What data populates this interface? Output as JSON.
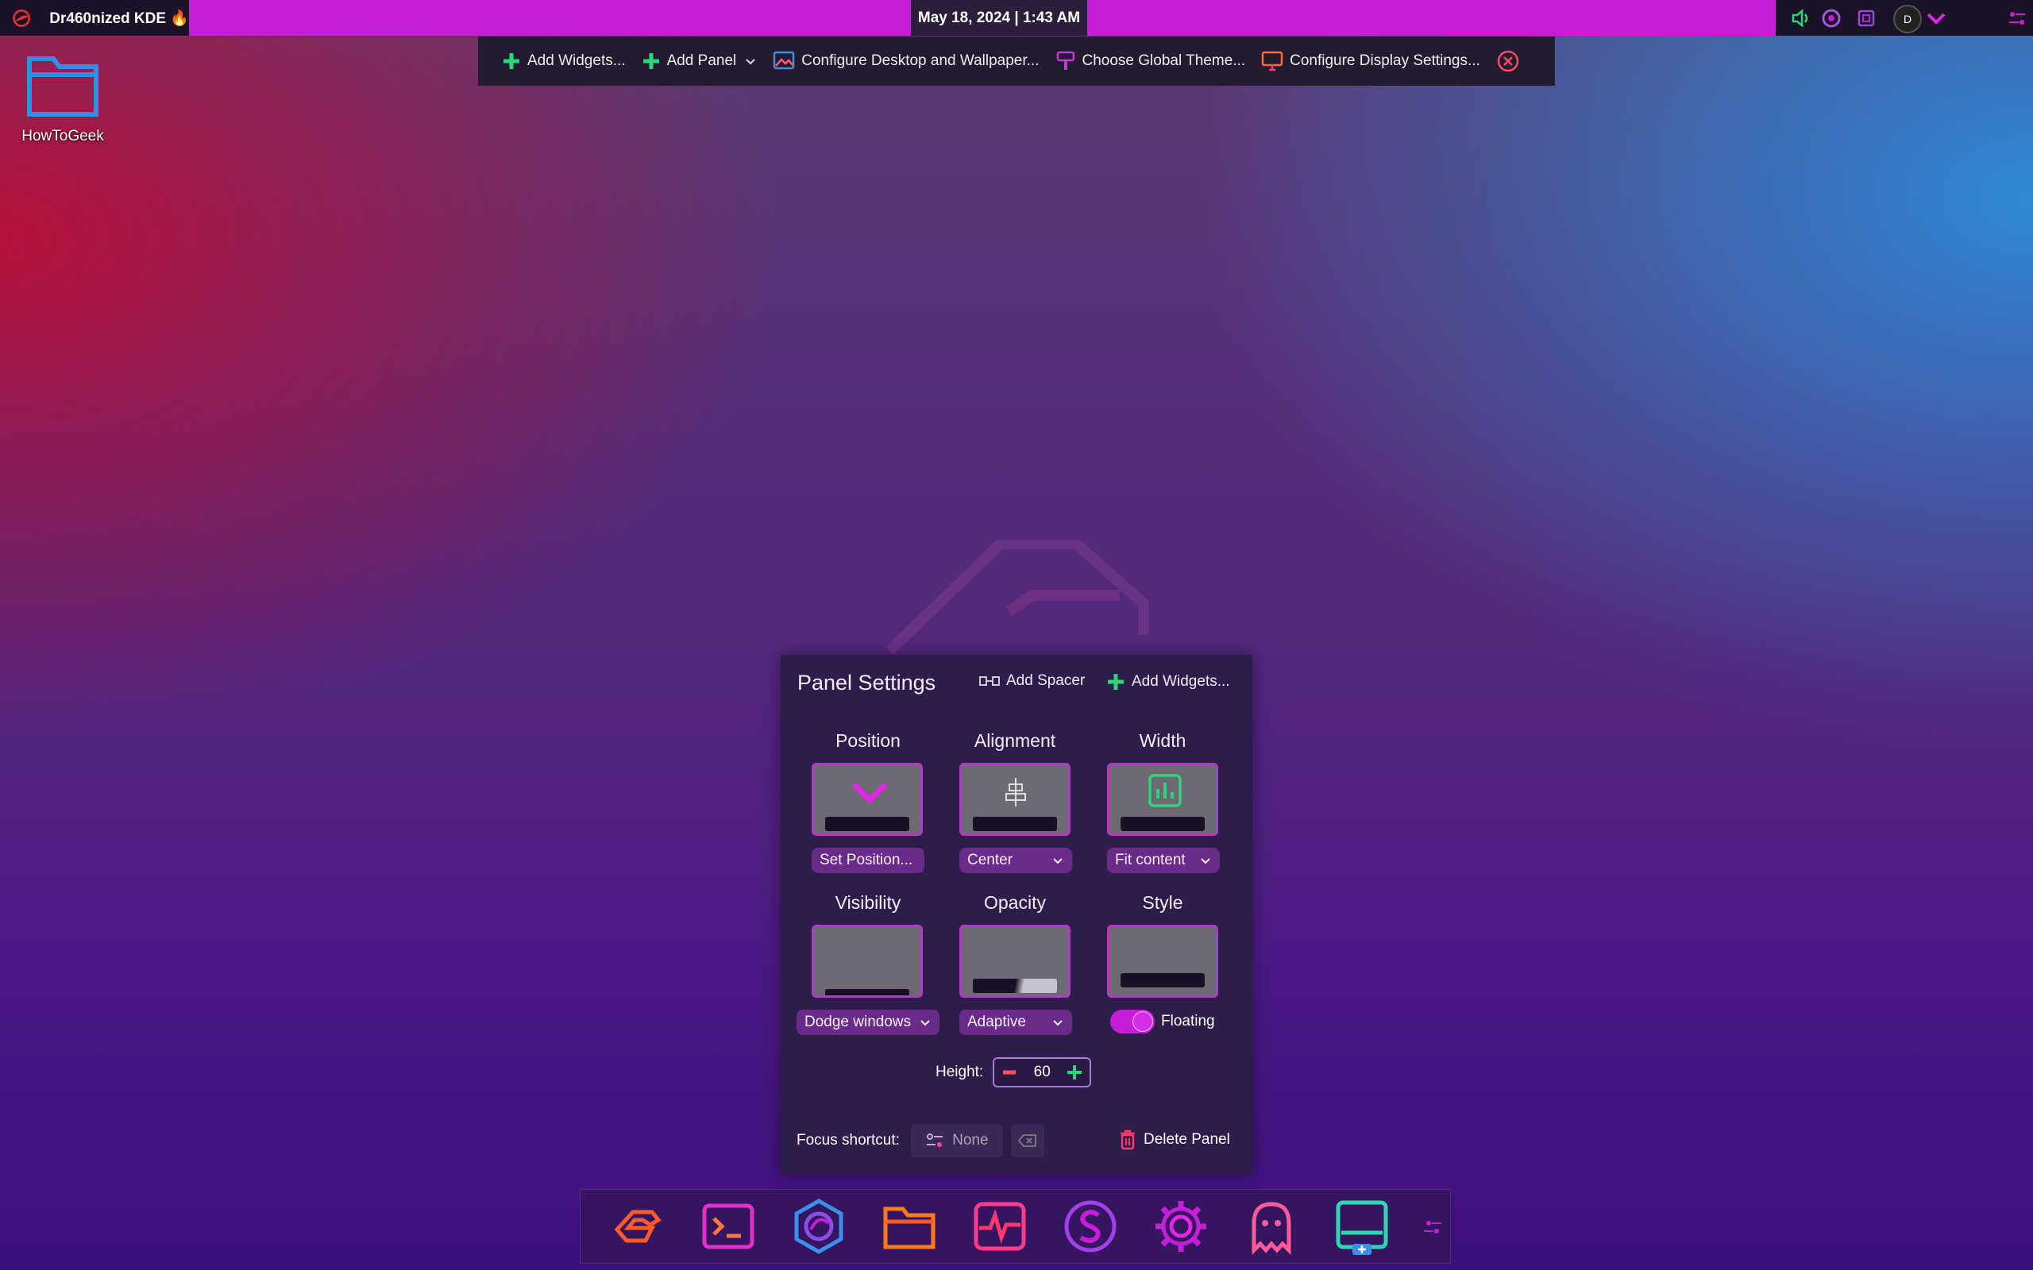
{
  "topbar": {
    "distro_title": "Dr460nized KDE 🔥",
    "clock": "May 18, 2024 | 1:43 AM",
    "avatar_initial": "D"
  },
  "toolbar": {
    "add_widgets": "Add Widgets...",
    "add_panel": "Add Panel",
    "configure_desktop": "Configure Desktop and Wallpaper...",
    "choose_theme": "Choose Global Theme...",
    "configure_display": "Configure Display Settings..."
  },
  "desktop": {
    "folder_label": "HowToGeek"
  },
  "panel_settings": {
    "title": "Panel Settings",
    "add_spacer": "Add Spacer",
    "add_widgets": "Add Widgets...",
    "position": {
      "label": "Position",
      "value": "Set Position..."
    },
    "alignment": {
      "label": "Alignment",
      "value": "Center"
    },
    "width": {
      "label": "Width",
      "value": "Fit content"
    },
    "visibility": {
      "label": "Visibility",
      "value": "Dodge windows"
    },
    "opacity": {
      "label": "Opacity",
      "value": "Adaptive"
    },
    "style": {
      "label": "Style",
      "value": "Floating",
      "floating_on": true
    },
    "height_label": "Height:",
    "height_value": "60",
    "focus_label": "Focus shortcut:",
    "focus_value": "None",
    "delete": "Delete Panel"
  },
  "colors": {
    "accent": "#c41fd6",
    "green": "#2bd67b",
    "panel_bg": "#2e1d4a"
  },
  "dock": {
    "icons": [
      "garuda-icon",
      "terminal-icon",
      "dragon-browser-icon",
      "files-icon",
      "system-monitor-icon",
      "s-app-icon",
      "settings-gear-icon",
      "ghost-icon",
      "panel-edit-icon"
    ]
  }
}
